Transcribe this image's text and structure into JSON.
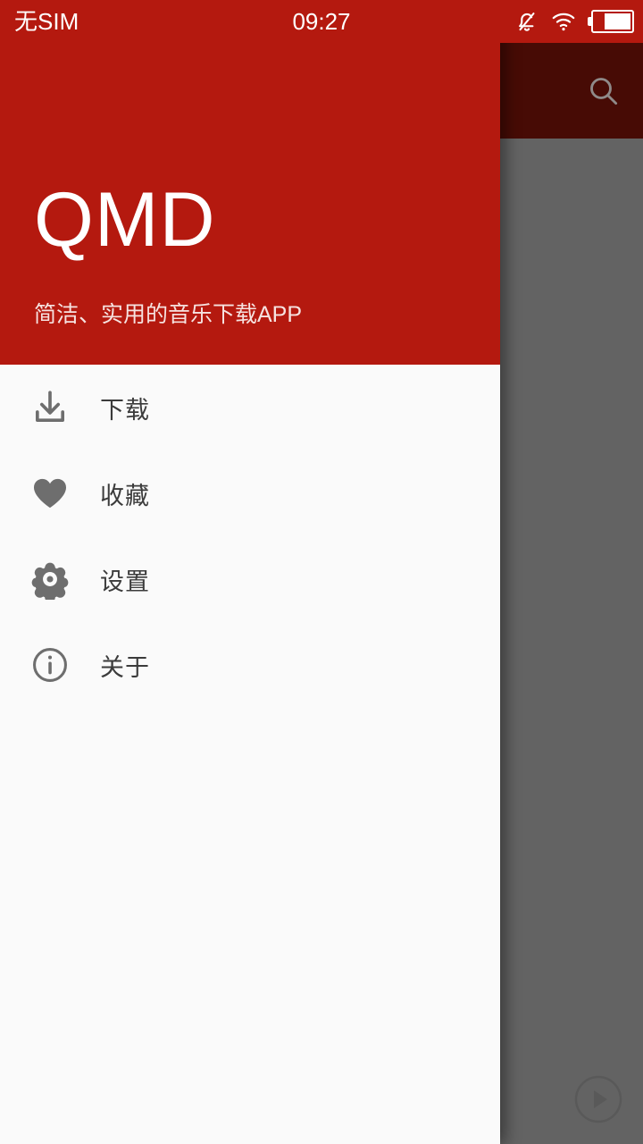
{
  "status_bar": {
    "carrier": "无SIM",
    "clock": "09:27",
    "icons": [
      {
        "name": "bell-muted-icon"
      },
      {
        "name": "wifi-icon"
      },
      {
        "name": "battery-icon"
      }
    ],
    "background_color": "#b4190f",
    "text_color": "#ffffff"
  },
  "drawer": {
    "background_color": "#fafafa",
    "header": {
      "background_color": "#b4190f",
      "title": "QMD",
      "subtitle": "简洁、实用的音乐下载APP"
    },
    "menu": {
      "items": [
        {
          "icon": "download-icon",
          "label": "下载"
        },
        {
          "icon": "heart-icon",
          "label": "收藏"
        },
        {
          "icon": "gear-icon",
          "label": "设置"
        },
        {
          "icon": "info-circle-icon",
          "label": "关于"
        }
      ]
    }
  },
  "app_behind": {
    "scrim_color": "#636363",
    "toolbar": {
      "background_color": "#470b05",
      "search_icon": "search-icon"
    },
    "fab": {
      "icon": "play-icon"
    }
  }
}
